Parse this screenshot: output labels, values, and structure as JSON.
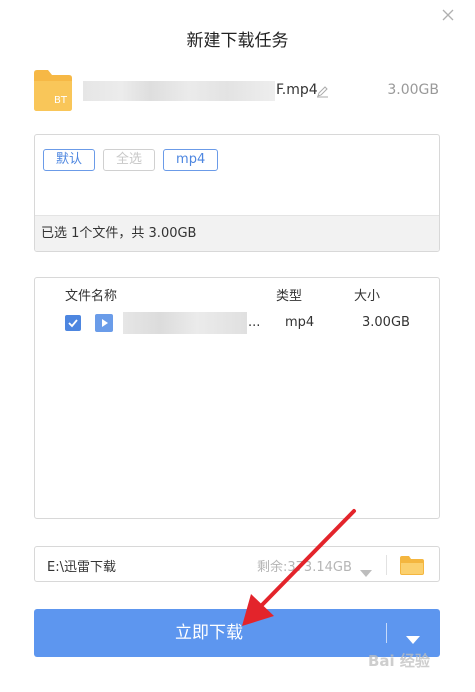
{
  "dialog": {
    "title": "新建下载任务"
  },
  "file_header": {
    "icon_label": "BT",
    "filename_suffix": "F.mp4",
    "size": "3.00GB"
  },
  "filters": {
    "tags": [
      {
        "label": "默认",
        "state": "active"
      },
      {
        "label": "全选",
        "state": "disabled"
      },
      {
        "label": "mp4",
        "state": "active"
      }
    ],
    "summary": "已选 1个文件，共 3.00GB"
  },
  "file_list": {
    "columns": {
      "name": "文件名称",
      "type": "类型",
      "size": "大小"
    },
    "rows": [
      {
        "checked": true,
        "name_suffix": "...",
        "type": "mp4",
        "size": "3.00GB"
      }
    ]
  },
  "save_path": {
    "path": "E:\\迅雷下载",
    "free_space": "剩余:373.14GB"
  },
  "actions": {
    "download_label": "立即下载"
  },
  "watermark": {
    "text": "Bai 经验"
  },
  "colors": {
    "accent": "#5d96ef",
    "tag_blue": "#4d86e0",
    "annotation": "#e3242b",
    "folder": "#f4b63f"
  }
}
